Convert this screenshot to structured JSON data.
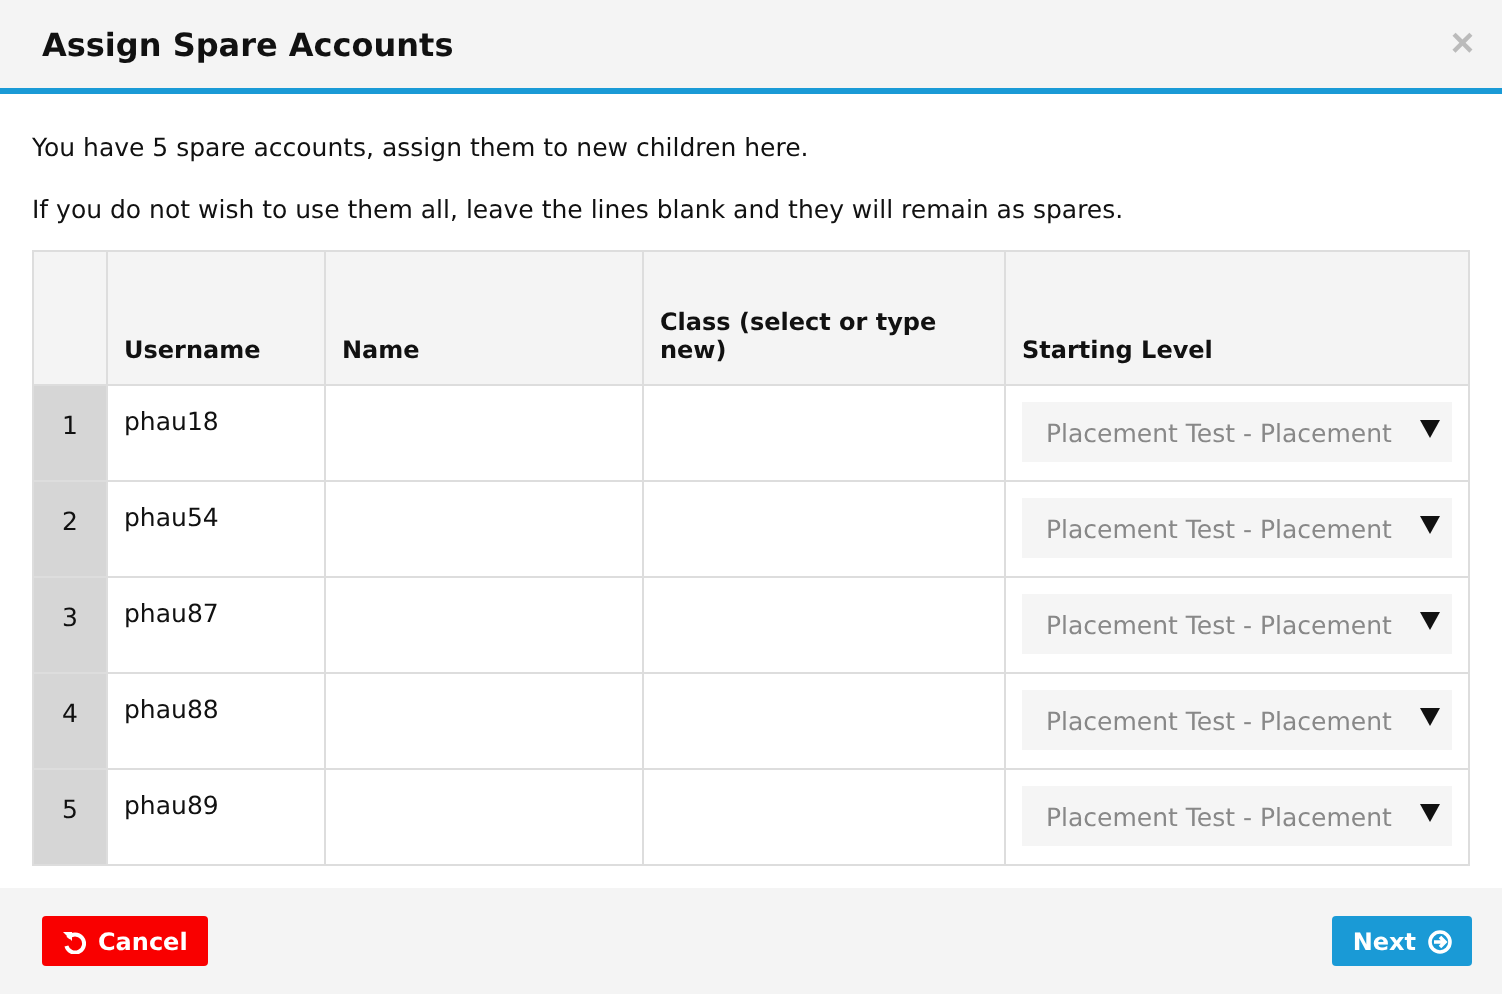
{
  "dialog": {
    "title": "Assign Spare Accounts",
    "close": "×"
  },
  "intro": [
    "You have 5 spare accounts, assign them to new children here.",
    "If you do not wish to use them all, leave the lines blank and they will remain as spares."
  ],
  "table": {
    "columns": [
      "Username",
      "Name",
      "Class (select or type new)",
      "Starting Level"
    ],
    "rows": [
      {
        "number": "1",
        "username": "phau18",
        "starting_level": "Placement Test - Placement"
      },
      {
        "number": "2",
        "username": "phau54",
        "starting_level": "Placement Test - Placement"
      },
      {
        "number": "3",
        "username": "phau87",
        "starting_level": "Placement Test - Placement"
      },
      {
        "number": "4",
        "username": "phau88",
        "starting_level": "Placement Test - Placement"
      },
      {
        "number": "5",
        "username": "phau89",
        "starting_level": "Placement Test - Placement"
      }
    ]
  },
  "buttons": {
    "cancel": "Cancel",
    "next": "Next"
  }
}
